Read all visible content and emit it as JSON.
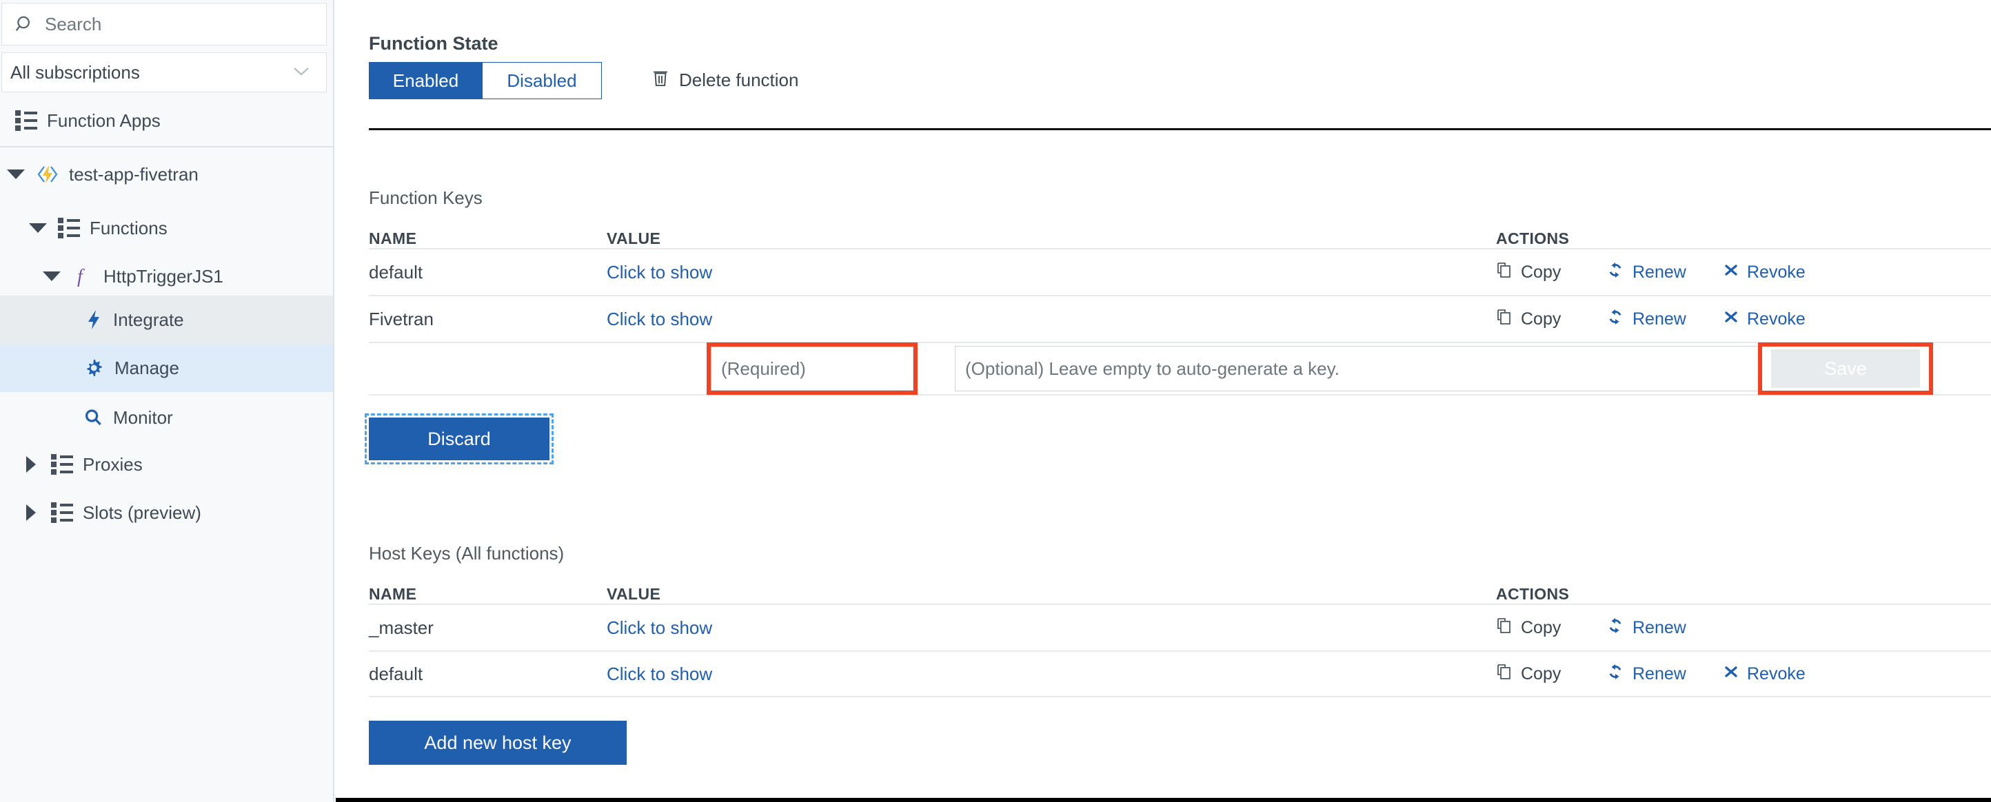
{
  "sidebar": {
    "search": {
      "placeholder": "Search",
      "icon": "search-icon"
    },
    "subscription_filter": {
      "value": "All subscriptions",
      "icon": "chevron-down-icon"
    },
    "nav": [
      {
        "label": "Function Apps",
        "icon": "list-icon",
        "indent": 0,
        "caret": "none",
        "state": "normal"
      }
    ],
    "tree": [
      {
        "label": "test-app-fivetran",
        "icon": "function-app-icon",
        "indent": 0,
        "caret": "down",
        "state": "normal"
      },
      {
        "label": "Functions",
        "icon": "list-icon",
        "indent": 1,
        "caret": "down",
        "state": "normal"
      },
      {
        "label": "HttpTriggerJS1",
        "icon": "function-icon",
        "indent": 2,
        "caret": "down",
        "state": "normal"
      },
      {
        "label": "Integrate",
        "icon": "bolt-icon",
        "indent": 3,
        "caret": "none",
        "state": "hover"
      },
      {
        "label": "Manage",
        "icon": "gear-icon",
        "indent": 3,
        "caret": "none",
        "state": "selected"
      },
      {
        "label": "Monitor",
        "icon": "magnifier-icon",
        "indent": 3,
        "caret": "none",
        "state": "normal"
      },
      {
        "label": "Proxies",
        "icon": "list-icon",
        "indent": 1,
        "caret": "right",
        "state": "normal"
      },
      {
        "label": "Slots (preview)",
        "icon": "list-icon",
        "indent": 1,
        "caret": "right",
        "state": "normal"
      }
    ]
  },
  "main": {
    "function_state": {
      "title": "Function State",
      "enabled_label": "Enabled",
      "disabled_label": "Disabled",
      "selected": "Enabled",
      "delete_label": "Delete function",
      "delete_icon": "trash-icon"
    },
    "function_keys": {
      "title": "Function Keys",
      "columns": [
        "NAME",
        "VALUE",
        "ACTIONS"
      ],
      "rows": [
        {
          "name": "default",
          "value": "Click to show",
          "actions": [
            "Copy",
            "Renew",
            "Revoke"
          ]
        },
        {
          "name": "Fivetran",
          "value": "Click to show",
          "actions": [
            "Copy",
            "Renew",
            "Revoke"
          ]
        }
      ],
      "new_key": {
        "name_placeholder": "(Required)",
        "name_value": "",
        "value_placeholder": "(Optional) Leave empty to auto-generate a key.",
        "value_value": "",
        "save_label": "Save",
        "save_disabled": true,
        "highlighted": [
          "name-input",
          "save-button"
        ]
      },
      "discard_label": "Discard"
    },
    "host_keys": {
      "title": "Host Keys (All functions)",
      "columns": [
        "NAME",
        "VALUE",
        "ACTIONS"
      ],
      "rows": [
        {
          "name": "_master",
          "value": "Click to show",
          "actions": [
            "Copy",
            "Renew"
          ]
        },
        {
          "name": "default",
          "value": "Click to show",
          "actions": [
            "Copy",
            "Renew",
            "Revoke"
          ]
        }
      ],
      "add_label": "Add new host key"
    },
    "action_labels": {
      "copy": "Copy",
      "renew": "Renew",
      "revoke": "Revoke"
    }
  },
  "colors": {
    "accent_blue": "#1f5fae",
    "highlight_red": "#f04323",
    "selected_bg": "#deecfa",
    "hover_bg": "#e9ecef",
    "sidebar_bg": "#f8f9fa"
  }
}
